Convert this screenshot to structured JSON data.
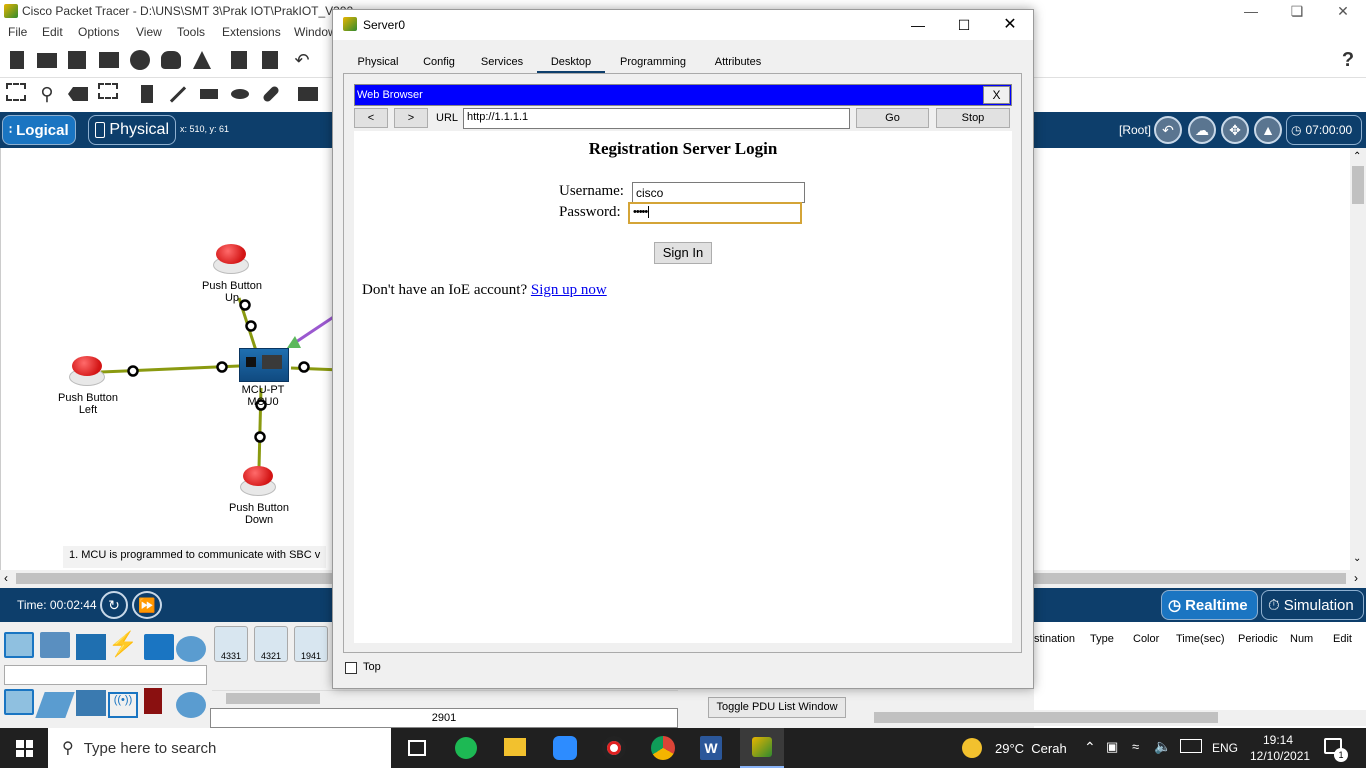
{
  "app": {
    "title": "Cisco Packet Tracer - D:\\UNS\\SMT 3\\Prak IOT\\PrakIOT_V392",
    "menu": [
      "File",
      "Edit",
      "Options",
      "View",
      "Tools",
      "Extensions",
      "Window"
    ]
  },
  "logical_bar": {
    "logical_label": "Logical",
    "physical_label": "Physical",
    "coords": "x: 510, y: 61",
    "root_label": "[Root]",
    "clock": "07:00:00"
  },
  "workspace": {
    "devices": [
      {
        "label_line1": "Push Button",
        "label_line2": "Up"
      },
      {
        "label_line1": "Push Button",
        "label_line2": "Left"
      },
      {
        "label_line1": "Push Button",
        "label_line2": "Down"
      },
      {
        "label_line1": "MCU-PT",
        "label_line2": "MCU0"
      }
    ],
    "note": "1. MCU is programmed to communicate with SBC v"
  },
  "timebar": {
    "time": "Time: 00:02:44",
    "realtime": "Realtime",
    "simulation": "Simulation"
  },
  "bottom": {
    "router_models": [
      "4331",
      "4321",
      "1941"
    ],
    "selected_model": "2901",
    "toggle_pdu": "Toggle PDU List Window",
    "pdu_columns": [
      "stination",
      "Type",
      "Color",
      "Time(sec)",
      "Periodic",
      "Num",
      "Edit"
    ]
  },
  "server_window": {
    "title": "Server0",
    "tabs": [
      "Physical",
      "Config",
      "Services",
      "Desktop",
      "Programming",
      "Attributes"
    ],
    "active_tab": "Desktop",
    "top_checkbox_label": "Top",
    "browser": {
      "header": "Web Browser",
      "close": "X",
      "back": "<",
      "forward": ">",
      "url_label": "URL",
      "url": "http://1.1.1.1",
      "go": "Go",
      "stop": "Stop"
    },
    "login": {
      "heading": "Registration Server Login",
      "username_label": "Username:",
      "username_value": "cisco",
      "password_label": "Password:",
      "password_value": "•••••",
      "sign_in": "Sign In",
      "signup_prompt": "Don't have an IoE account?",
      "signup_link": "Sign up now"
    }
  },
  "taskbar": {
    "search_placeholder": "Type here to search",
    "weather": "29°C  Cerah",
    "lang": "ENG",
    "time": "19:14",
    "date": "12/10/2021",
    "notifications": "1"
  },
  "colors": {
    "navy": "#0d3e6b",
    "browser_header": "#0000ff",
    "link": "#0000ee",
    "button_red": "#d31515",
    "link_line": "#8a9a10",
    "wireless_line": "#9b59d0"
  }
}
